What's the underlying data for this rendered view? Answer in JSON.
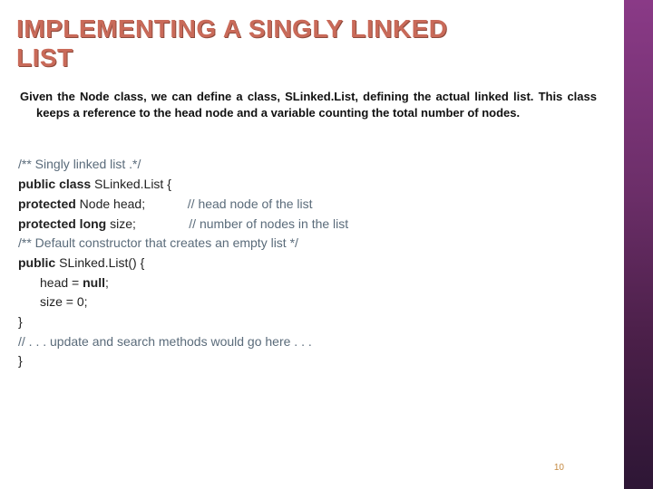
{
  "title": "IMPLEMENTING A SINGLY LINKED\nLIST",
  "body": "Given the Node class, we can define a class, SLinked.List, defining the actual linked list. This class keeps a reference to the head node and a variable counting the total number of nodes.",
  "code": {
    "l1": "/** Singly linked list .*/",
    "l2a": "public class",
    "l2b": " SLinked.List {",
    "l3a": "protected",
    "l3b": " Node head;",
    "l3c": "// head node of the list",
    "l4a": "protected long",
    "l4b": " size;",
    "l4c": "// number of nodes in the list",
    "l5": "/** Default constructor that creates an empty list */",
    "l6a": "public",
    "l6b": " SLinked.List() {",
    "l7a": "head = ",
    "l7b": "null",
    "l7c": ";",
    "l8": "size = 0;",
    "l9": "}",
    "l10": "// . . . update and search methods would go here . . .",
    "l11": "}"
  },
  "page_number": "10"
}
